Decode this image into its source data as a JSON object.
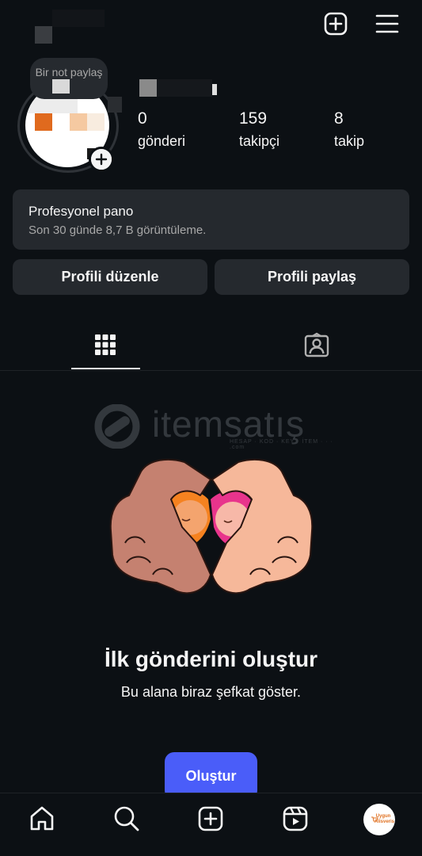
{
  "header": {
    "icons": [
      "new-post-icon",
      "menu-icon"
    ]
  },
  "note": {
    "text": "Bir not paylaş"
  },
  "stats": [
    {
      "value": "0",
      "label": "gönderi"
    },
    {
      "value": "159",
      "label": "takipçi"
    },
    {
      "value": "8",
      "label": "takip"
    }
  ],
  "dashboard": {
    "title": "Profesyonel pano",
    "subtitle": "Son 30 günde 8,7 B görüntüleme."
  },
  "actions": {
    "edit": "Profili düzenle",
    "share": "Profili paylaş"
  },
  "tabs": [
    {
      "name": "grid",
      "icon": "grid-icon",
      "active": true
    },
    {
      "name": "tagged",
      "icon": "tagged-icon",
      "active": false
    }
  ],
  "watermark": {
    "text": "itemsatış",
    "tagline": "HESAP · KOD · KEY · İTEM · · · .com"
  },
  "empty_state": {
    "title": "İlk gönderini oluştur",
    "subtitle": "Bu alana biraz şefkat göster.",
    "button": "Oluştur"
  },
  "bottom_nav": {
    "items": [
      "home-icon",
      "search-icon",
      "create-icon",
      "reels-icon",
      "profile-avatar"
    ],
    "avatar_text": "Uygun Alisveris"
  },
  "colors": {
    "background": "#0c1014",
    "card": "#25292e",
    "accent": "#4a5df9",
    "muted_text": "#a8a8a8"
  }
}
